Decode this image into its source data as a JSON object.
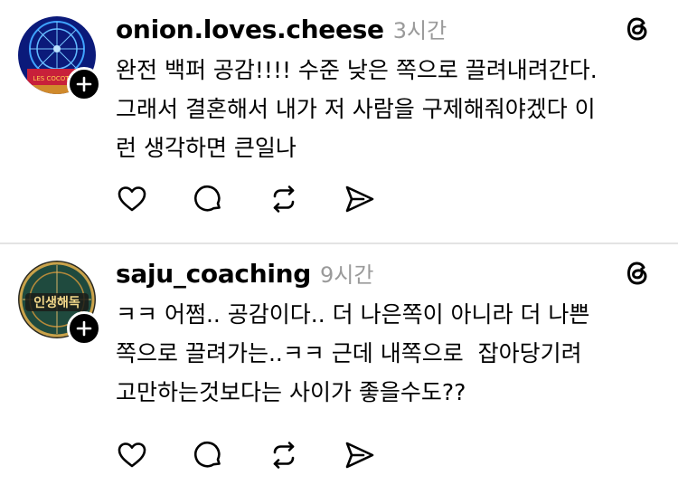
{
  "posts": [
    {
      "username": "onion.loves.cheese",
      "time": "3시간",
      "avatar_text": "LES COCOTTES",
      "text": "완전 백퍼 공감!!!! 수준 낮은 쪽으로 끌려내려간다.\n그래서 결혼해서 내가 저 사람을 구제해줘야겠다 이\n런 생각하면 큰일나"
    },
    {
      "username": "saju_coaching",
      "time": "9시간",
      "avatar_text": "인생해독",
      "text": "ㅋㅋ 어쩜.. 공감이다.. 더 나은쪽이 아니라 더 나쁜\n쪽으로 끌려가는..ㅋㅋ 근데 내쪽으로  잡아당기려\n고만하는것보다는 사이가 좋을수도??"
    }
  ],
  "icons": {
    "follow": "plus-icon",
    "app": "threads-logo-icon",
    "actions": [
      "heart-icon",
      "comment-icon",
      "repost-icon",
      "share-icon"
    ]
  }
}
